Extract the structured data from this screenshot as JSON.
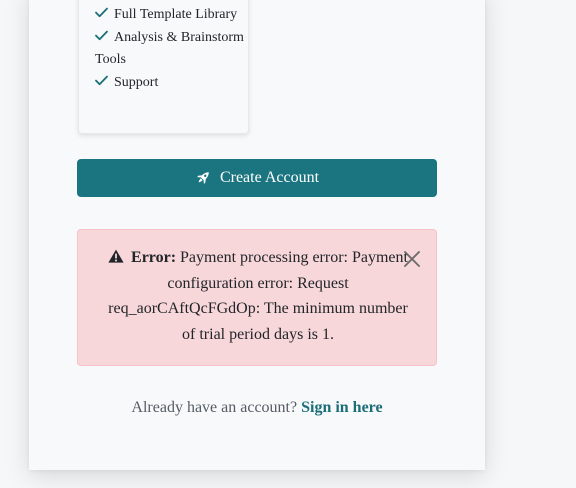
{
  "plan_features": {
    "items": [
      {
        "label": "Full Template Library"
      },
      {
        "label": "Analysis & Brainstorm Tools"
      },
      {
        "label": "Support"
      }
    ],
    "check_icon": "checkmark-icon",
    "check_color": "#1b6e78"
  },
  "create_account": {
    "label": "Create Account",
    "icon": "rocket-icon",
    "background": "#1b7580"
  },
  "error_alert": {
    "prefix": "Error:",
    "message": "Payment processing error: Payment configuration error: Request req_aorCAftQcFGdOp: The minimum number of trial period days is 1.",
    "icon": "warning-triangle-icon",
    "close_icon": "close-icon",
    "background": "#f8d7da",
    "border": "#f5c2c7"
  },
  "signin": {
    "prompt": "Already have an account?",
    "link_label": "Sign in here",
    "link_color": "#1b6e78"
  }
}
